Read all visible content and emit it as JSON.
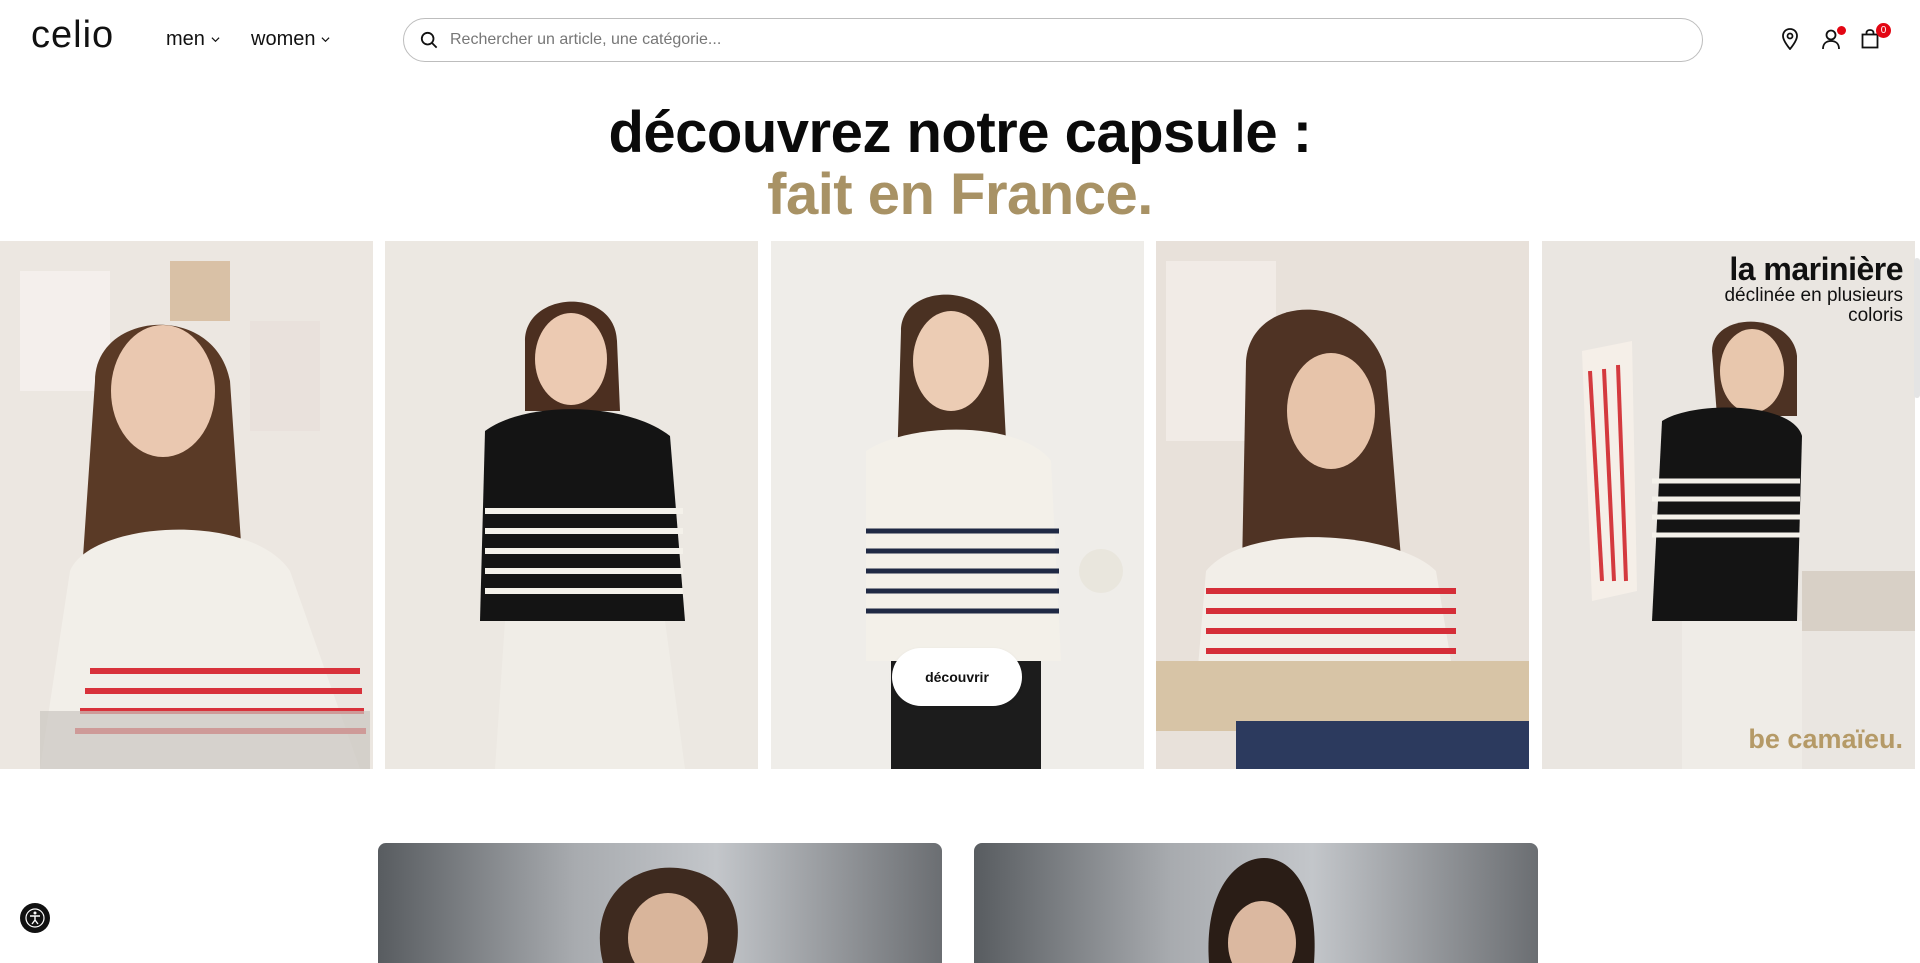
{
  "header": {
    "logo": "celio",
    "nav": [
      {
        "label": "men"
      },
      {
        "label": "women"
      }
    ],
    "search": {
      "placeholder": "Rechercher un article, une catégorie..."
    },
    "icons": [
      "location-icon",
      "account-icon",
      "cart-icon"
    ],
    "cart_count": "0"
  },
  "hero": {
    "title": "découvrez notre capsule :",
    "subtitle": "fait en France.",
    "cta_label": "découvrir",
    "promo": {
      "title": "la marinière",
      "subtitle": "déclinée en plusieurs coloris",
      "brand": "be camaïeu."
    }
  },
  "colors": {
    "accent_gold": "#a89265",
    "badge_red": "#e30613"
  }
}
